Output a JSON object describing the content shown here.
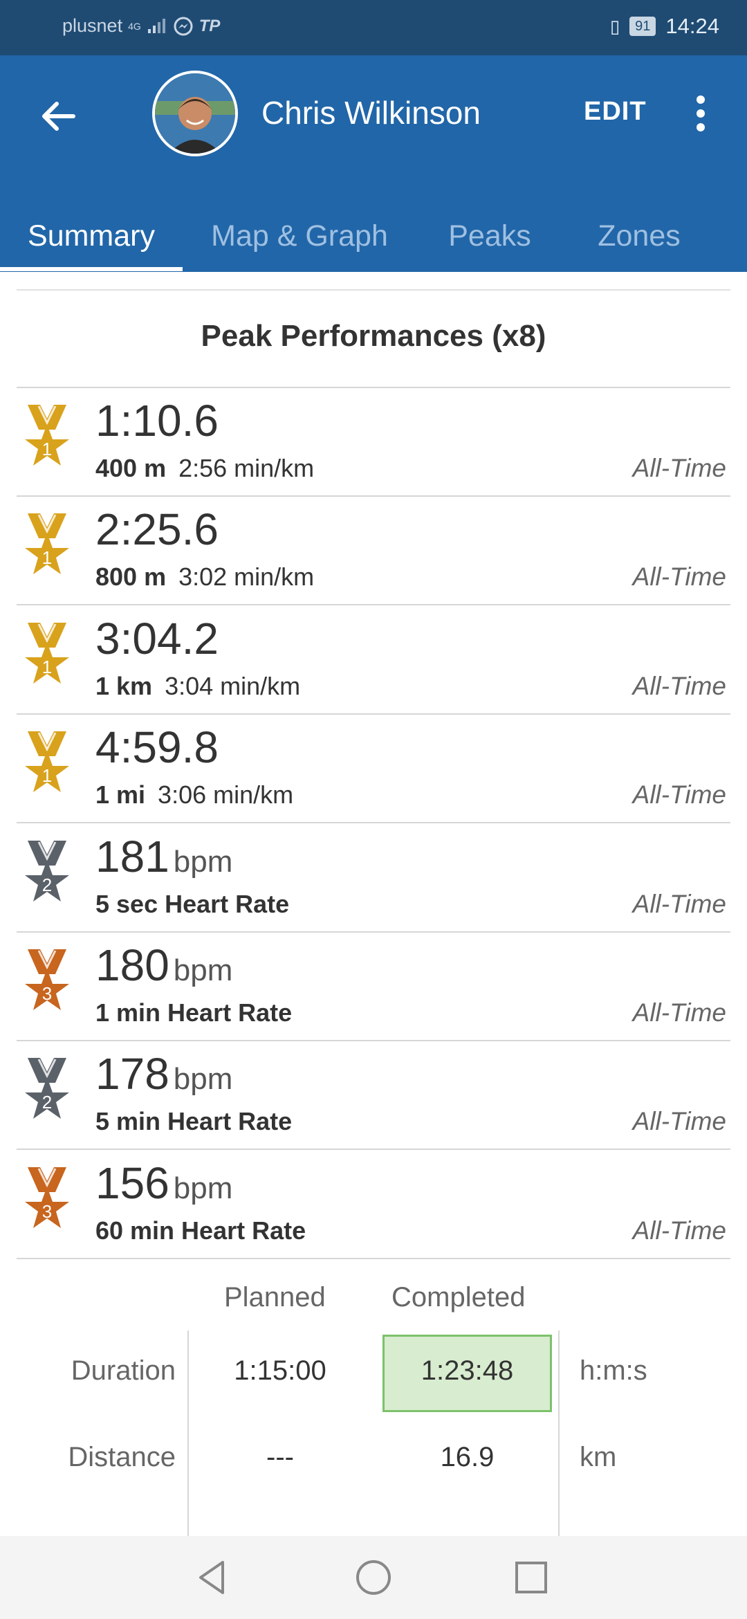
{
  "status_bar": {
    "carrier": "plusnet",
    "network": "4G",
    "app_icon_text": "TP",
    "battery": "91",
    "time": "14:24"
  },
  "header": {
    "user_name": "Chris Wilkinson",
    "edit_label": "EDIT"
  },
  "tabs": [
    {
      "label": "Summary",
      "active": true
    },
    {
      "label": "Map & Graph",
      "active": false
    },
    {
      "label": "Peaks",
      "active": false
    },
    {
      "label": "Zones",
      "active": false
    }
  ],
  "peaks": {
    "title": "Peak Performances (x8)",
    "rows": [
      {
        "value": "1:10.6",
        "unit": "",
        "distance": "400 m",
        "pace": "2:56 min/km",
        "scope": "All-Time",
        "rank": "1",
        "medal_color": "#d9a21c"
      },
      {
        "value": "2:25.6",
        "unit": "",
        "distance": "800 m",
        "pace": "3:02 min/km",
        "scope": "All-Time",
        "rank": "1",
        "medal_color": "#d9a21c"
      },
      {
        "value": "3:04.2",
        "unit": "",
        "distance": "1 km",
        "pace": "3:04 min/km",
        "scope": "All-Time",
        "rank": "1",
        "medal_color": "#d9a21c"
      },
      {
        "value": "4:59.8",
        "unit": "",
        "distance": "1 mi",
        "pace": "3:06 min/km",
        "scope": "All-Time",
        "rank": "1",
        "medal_color": "#d9a21c"
      },
      {
        "value": "181",
        "unit": "bpm",
        "distance": "5 sec Heart Rate",
        "pace": "",
        "scope": "All-Time",
        "rank": "2",
        "medal_color": "#5b6169"
      },
      {
        "value": "180",
        "unit": "bpm",
        "distance": "1 min Heart Rate",
        "pace": "",
        "scope": "All-Time",
        "rank": "3",
        "medal_color": "#c8651e"
      },
      {
        "value": "178",
        "unit": "bpm",
        "distance": "5 min Heart Rate",
        "pace": "",
        "scope": "All-Time",
        "rank": "2",
        "medal_color": "#5b6169"
      },
      {
        "value": "156",
        "unit": "bpm",
        "distance": "60 min Heart Rate",
        "pace": "",
        "scope": "All-Time",
        "rank": "3",
        "medal_color": "#c8651e"
      }
    ]
  },
  "planned_completed": {
    "headers": {
      "planned": "Planned",
      "completed": "Completed"
    },
    "rows": [
      {
        "label": "Duration",
        "planned": "1:15:00",
        "completed": "1:23:48",
        "unit": "h:m:s"
      },
      {
        "label": "Distance",
        "planned": "---",
        "completed": "16.9",
        "unit": "km"
      }
    ]
  },
  "colors": {
    "status_bar": "#1f4b73",
    "app_bar": "#2166a8",
    "completed_fill": "#d8ecd0",
    "completed_border": "#7cc26a"
  }
}
